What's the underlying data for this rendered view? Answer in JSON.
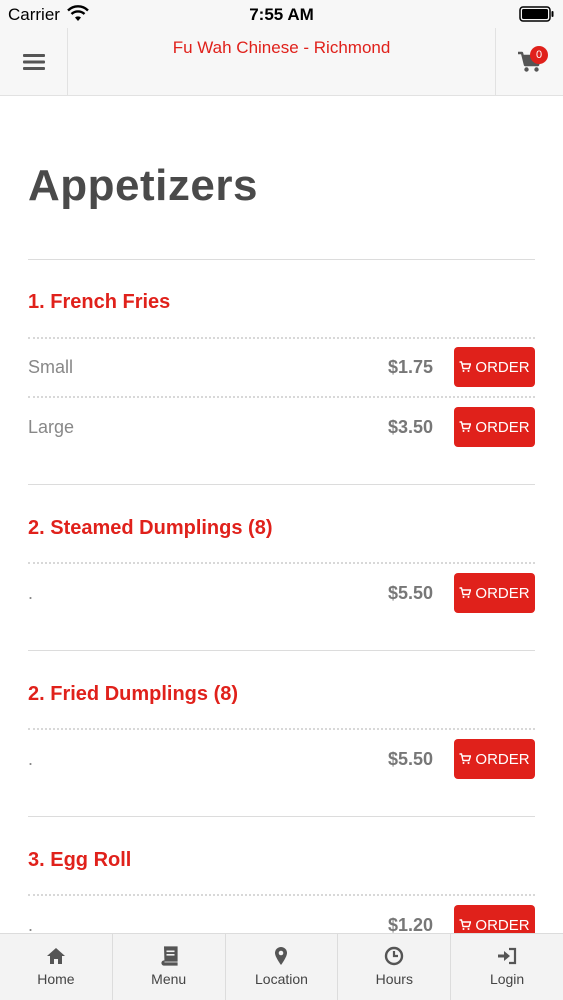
{
  "status_bar": {
    "carrier": "Carrier",
    "time": "7:55 AM"
  },
  "nav": {
    "title": "Fu Wah Chinese - Richmond",
    "cart_count": "0"
  },
  "category": {
    "title": "Appetizers"
  },
  "items": [
    {
      "name": "1. French Fries",
      "options": [
        {
          "label": "Small",
          "price": "$1.75",
          "button": "ORDER"
        },
        {
          "label": "Large",
          "price": "$3.50",
          "button": "ORDER"
        }
      ]
    },
    {
      "name": "2. Steamed Dumplings (8)",
      "options": [
        {
          "label": ".",
          "price": "$5.50",
          "button": "ORDER"
        }
      ]
    },
    {
      "name": "2. Fried Dumplings (8)",
      "options": [
        {
          "label": ".",
          "price": "$5.50",
          "button": "ORDER"
        }
      ]
    },
    {
      "name": "3. Egg Roll",
      "options": [
        {
          "label": ".",
          "price": "$1.20",
          "button": "ORDER"
        }
      ]
    }
  ],
  "tabs": [
    {
      "label": "Home",
      "icon": "home-icon"
    },
    {
      "label": "Menu",
      "icon": "book-icon"
    },
    {
      "label": "Location",
      "icon": "map-pin-icon"
    },
    {
      "label": "Hours",
      "icon": "clock-icon"
    },
    {
      "label": "Login",
      "icon": "sign-in-icon"
    }
  ],
  "colors": {
    "brand": "#e0211b",
    "heading": "#4a4a4a",
    "muted": "#888888"
  }
}
